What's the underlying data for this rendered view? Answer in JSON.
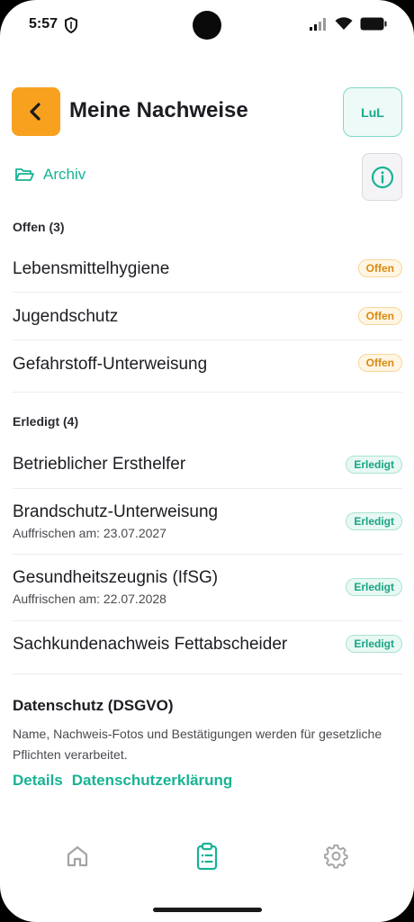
{
  "status_bar": {
    "time": "5:57"
  },
  "header": {
    "title": "Meine Nachweise",
    "profile_label": "LuL"
  },
  "archive": {
    "label": "Archiv"
  },
  "open_section": {
    "label": "Offen (3)",
    "items": [
      {
        "title": "Lebensmittelhygiene",
        "badge": "Offen"
      },
      {
        "title": "Jugendschutz",
        "badge": "Offen"
      },
      {
        "title": "Gefahrstoff-Unterweisung",
        "badge": "Offen"
      }
    ]
  },
  "done_section": {
    "label": "Erledigt (4)",
    "items": [
      {
        "title": "Betrieblicher Ersthelfer",
        "subtitle": "",
        "badge": "Erledigt"
      },
      {
        "title": "Brandschutz-Unterweisung",
        "subtitle": "Auffrischen am: 23.07.2027",
        "badge": "Erledigt"
      },
      {
        "title": "Gesundheitszeugnis (IfSG)",
        "subtitle": "Auffrischen am: 22.07.2028",
        "badge": "Erledigt"
      },
      {
        "title": "Sachkundenachweis Fettabscheider",
        "subtitle": "",
        "badge": "Erledigt"
      }
    ]
  },
  "privacy": {
    "title": "Datenschutz (DSGVO)",
    "text": "Name, Nachweis-Fotos und Bestätigungen werden für gesetzliche Pflichten verarbeitet.",
    "details_link": "Details",
    "policy_link": "Datenschutzerklärung"
  },
  "tab_bar": {
    "tabs": [
      {
        "icon": "home-icon",
        "active": false
      },
      {
        "icon": "clipboard-list-icon",
        "active": true
      },
      {
        "icon": "gear-icon",
        "active": false
      }
    ]
  },
  "colors": {
    "accent": "#18b394",
    "back_button": "#f7a11f",
    "open_badge": "#d98a12",
    "done_badge": "#17a585"
  }
}
